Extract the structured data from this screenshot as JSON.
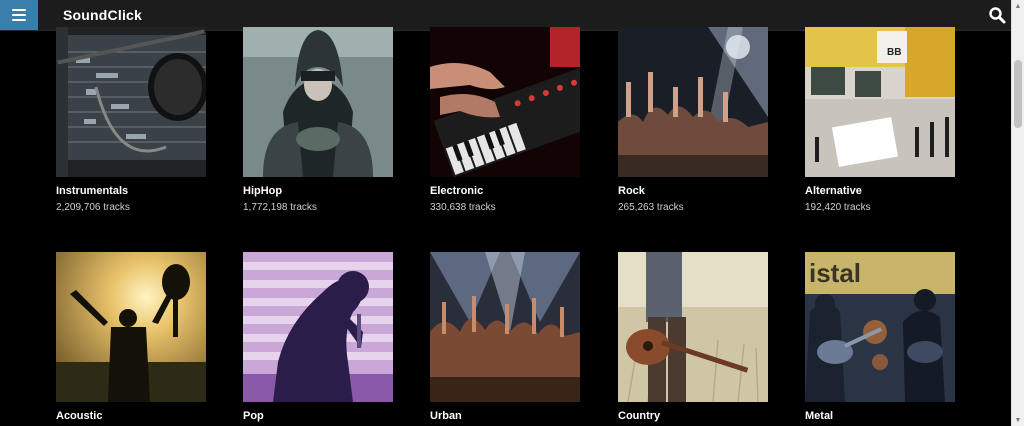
{
  "header": {
    "brand": "SoundClick",
    "accent_color": "#3a7fab",
    "menu_icon": "hamburger-menu-icon",
    "search_icon": "search-icon"
  },
  "genres": [
    {
      "name": "Instrumentals",
      "count": "2,209,706 tracks"
    },
    {
      "name": "HipHop",
      "count": "1,772,198 tracks"
    },
    {
      "name": "Electronic",
      "count": "330,638 tracks"
    },
    {
      "name": "Rock",
      "count": "265,263 tracks"
    },
    {
      "name": "Alternative",
      "count": "192,420 tracks"
    },
    {
      "name": "Acoustic",
      "count": ""
    },
    {
      "name": "Pop",
      "count": ""
    },
    {
      "name": "Urban",
      "count": ""
    },
    {
      "name": "Country",
      "count": ""
    },
    {
      "name": "Metal",
      "count": ""
    }
  ]
}
